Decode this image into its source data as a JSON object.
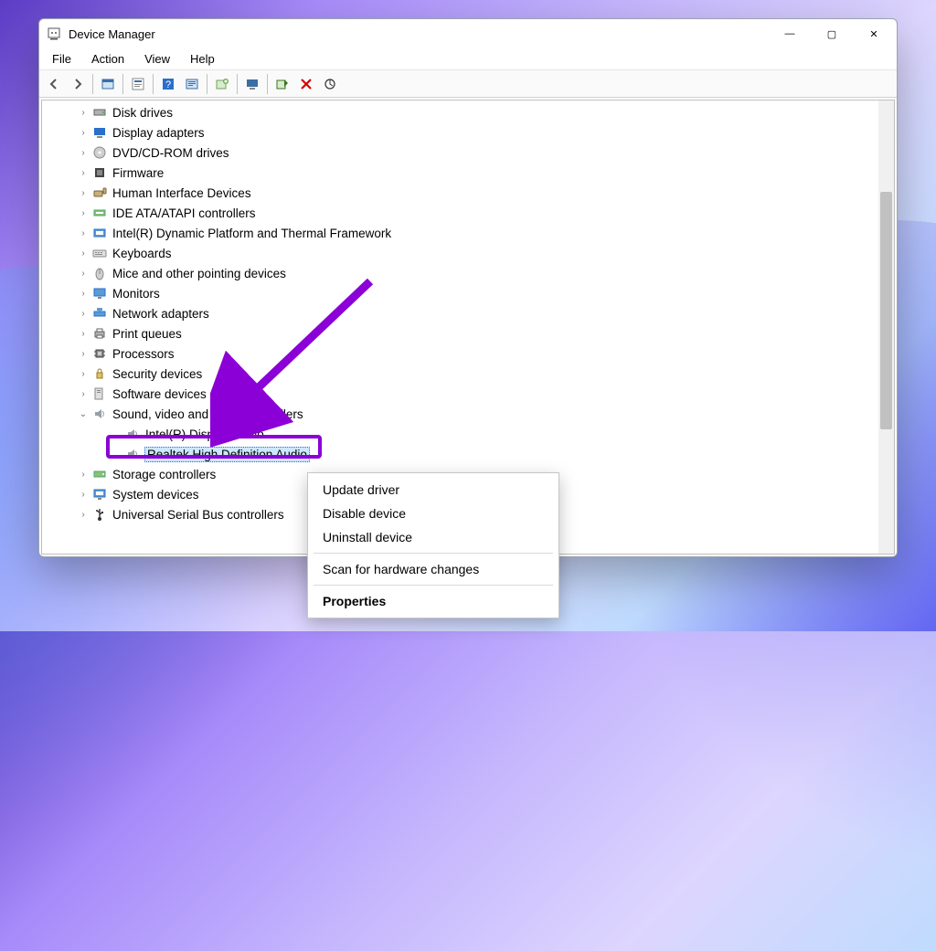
{
  "window": {
    "title": "Device Manager",
    "buttons": {
      "min": "—",
      "max": "▢",
      "close": "✕"
    }
  },
  "menubar": [
    "File",
    "Action",
    "View",
    "Help"
  ],
  "toolbar_icons": [
    "back",
    "forward",
    "sep",
    "show-hidden",
    "sep",
    "properties-pane",
    "sep",
    "help",
    "update-hardware",
    "sep",
    "uninstall",
    "sep",
    "action-center",
    "sep",
    "enable-device",
    "disable-device",
    "scan-hardware"
  ],
  "tree": {
    "categories": [
      {
        "label": "Disk drives",
        "icon": "disk",
        "expanded": false
      },
      {
        "label": "Display adapters",
        "icon": "display",
        "expanded": false
      },
      {
        "label": "DVD/CD-ROM drives",
        "icon": "dvd",
        "expanded": false
      },
      {
        "label": "Firmware",
        "icon": "firmware",
        "expanded": false
      },
      {
        "label": "Human Interface Devices",
        "icon": "hid",
        "expanded": false
      },
      {
        "label": "IDE ATA/ATAPI controllers",
        "icon": "ide",
        "expanded": false
      },
      {
        "label": "Intel(R) Dynamic Platform and Thermal Framework",
        "icon": "intel",
        "expanded": false
      },
      {
        "label": "Keyboards",
        "icon": "keyboard",
        "expanded": false
      },
      {
        "label": "Mice and other pointing devices",
        "icon": "mouse",
        "expanded": false
      },
      {
        "label": "Monitors",
        "icon": "monitor",
        "expanded": false
      },
      {
        "label": "Network adapters",
        "icon": "network",
        "expanded": false
      },
      {
        "label": "Print queues",
        "icon": "printer",
        "expanded": false
      },
      {
        "label": "Processors",
        "icon": "cpu",
        "expanded": false
      },
      {
        "label": "Security devices",
        "icon": "security",
        "expanded": false
      },
      {
        "label": "Software devices",
        "icon": "software",
        "expanded": false
      },
      {
        "label": "Sound, video and game controllers",
        "icon": "sound",
        "expanded": true,
        "children": [
          {
            "label": "Intel(R) Display Audio",
            "icon": "speaker"
          },
          {
            "label": "Realtek High Definition Audio",
            "icon": "speaker",
            "selected": true
          }
        ]
      },
      {
        "label": "Storage controllers",
        "icon": "storage",
        "expanded": false
      },
      {
        "label": "System devices",
        "icon": "system",
        "expanded": false
      },
      {
        "label": "Universal Serial Bus controllers",
        "icon": "usb",
        "expanded": false
      }
    ]
  },
  "context_menu": {
    "items": [
      {
        "label": "Update driver",
        "type": "item"
      },
      {
        "label": "Disable device",
        "type": "item"
      },
      {
        "label": "Uninstall device",
        "type": "item",
        "highlighted": true
      },
      {
        "type": "sep"
      },
      {
        "label": "Scan for hardware changes",
        "type": "item"
      },
      {
        "type": "sep"
      },
      {
        "label": "Properties",
        "type": "item",
        "bold": true
      }
    ]
  },
  "annotations": {
    "arrow_color": "#8b00d6",
    "highlight_color": "#8b00d6"
  }
}
